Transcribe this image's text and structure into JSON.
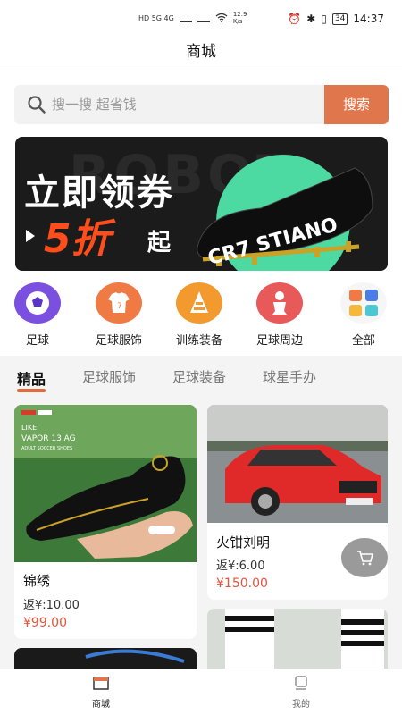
{
  "status": {
    "network_left": "HD 5G 4G",
    "speed_value": "12.9",
    "speed_unit": "K/s",
    "battery": "34",
    "time": "14:37"
  },
  "title": "商城",
  "search": {
    "placeholder": "搜一搜 超省钱",
    "button_label": "搜索"
  },
  "banner": {
    "headline": "立即领券",
    "discount": "5折",
    "suffix": "起",
    "shoe_text": "CR7 STIANO",
    "bg_text": "ROBOT"
  },
  "categories": [
    {
      "label": "足球",
      "icon": "soccer-ball-icon",
      "color": "#7b4fe0"
    },
    {
      "label": "足球服饰",
      "icon": "jersey-icon",
      "color": "#f07a44"
    },
    {
      "label": "训练装备",
      "icon": "cone-icon",
      "color": "#f29a2e"
    },
    {
      "label": "足球周边",
      "icon": "figurine-icon",
      "color": "#e85a5a"
    },
    {
      "label": "全部",
      "icon": "grid-icon",
      "color": "#f2f2f2"
    }
  ],
  "tabs": [
    {
      "label": "精品",
      "active": true
    },
    {
      "label": "足球服饰",
      "active": false
    },
    {
      "label": "足球装备",
      "active": false
    },
    {
      "label": "球星手办",
      "active": false
    }
  ],
  "products": [
    {
      "name": "锦绣",
      "rebate": "返¥:10.00",
      "price": "¥99.00",
      "image_label": "LIKE",
      "image_sublabel": "VAPOR 13 AG",
      "image_caption": "ADULT SOCCER SHOES"
    },
    {
      "name": "火钳刘明",
      "rebate": "返¥:6.00",
      "price": "¥150.00"
    }
  ],
  "bottom_nav": [
    {
      "label": "商城",
      "icon": "shop-icon",
      "active": true
    },
    {
      "label": "我的",
      "icon": "profile-icon",
      "active": false
    }
  ],
  "colors": {
    "accent": "#e0764c",
    "price": "#e5533c"
  }
}
